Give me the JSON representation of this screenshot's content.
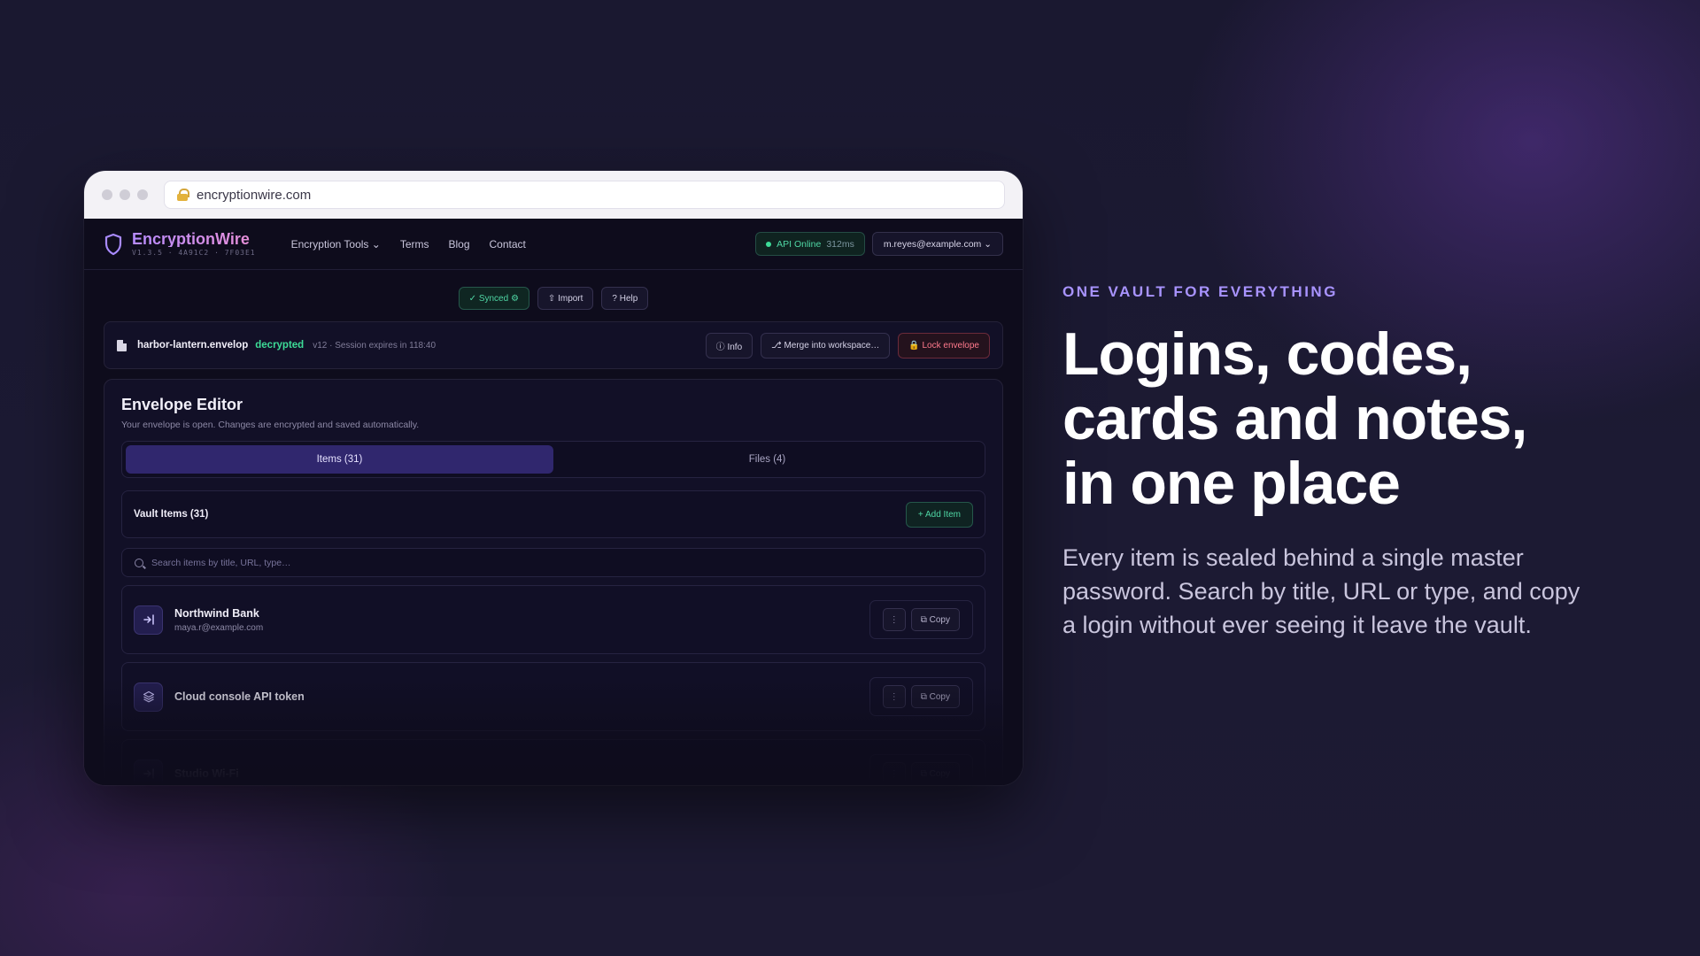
{
  "browser": {
    "url": "encryptionwire.com"
  },
  "app": {
    "brand": {
      "name": "EncryptionWire",
      "version": "V1.3.5 · 4A91C2 · 7F03E1"
    },
    "nav": {
      "links": [
        "Encryption Tools ⌄",
        "Terms",
        "Blog",
        "Contact"
      ]
    },
    "api_status": {
      "label": "API Online",
      "latency": "312ms"
    },
    "user": {
      "email": "m.reyes@example.com ⌄"
    },
    "toolbar": {
      "synced": "✓ Synced ⚙",
      "import": "⇧ Import",
      "help": "? Help"
    },
    "envelope": {
      "filename": "harbor-lantern.envelop",
      "status": "decrypted",
      "meta": "v12 · Session expires in 118:40",
      "info_label": "ⓘ Info",
      "merge_label": "⎇ Merge into workspace…",
      "lock_label": "🔒 Lock envelope"
    },
    "editor": {
      "title": "Envelope Editor",
      "subtitle": "Your envelope is open. Changes are encrypted and saved automatically.",
      "tabs": [
        "Items (31)",
        "Files (4)"
      ],
      "vault_title": "Vault Items (31)",
      "add_label": "+ Add Item",
      "search_placeholder": "Search items by title, URL, type…",
      "items": [
        {
          "title": "Northwind Bank",
          "subtitle": "maya.r@example.com",
          "icon": "login-icon",
          "copy": "⧉ Copy",
          "more": "⋮"
        },
        {
          "title": "Cloud console API token",
          "subtitle": "",
          "icon": "layers-icon",
          "copy": "⧉ Copy",
          "more": "⋮"
        },
        {
          "title": "Studio Wi-Fi",
          "subtitle": "",
          "icon": "login-icon",
          "copy": "⧉ Copy",
          "more": "⋮"
        }
      ]
    }
  },
  "hero": {
    "eyebrow": "ONE VAULT FOR EVERYTHING",
    "headline_lines": [
      "Logins, codes,",
      "cards and notes,",
      "in one place"
    ],
    "body": "Every item is sealed behind a single master password. Search by title, URL or type, and copy a login without ever seeing it leave the vault."
  },
  "colors": {
    "accent": "#a893ff",
    "success": "#3ddc97",
    "danger": "#ff7a8c",
    "active_tab": "#30276e"
  }
}
